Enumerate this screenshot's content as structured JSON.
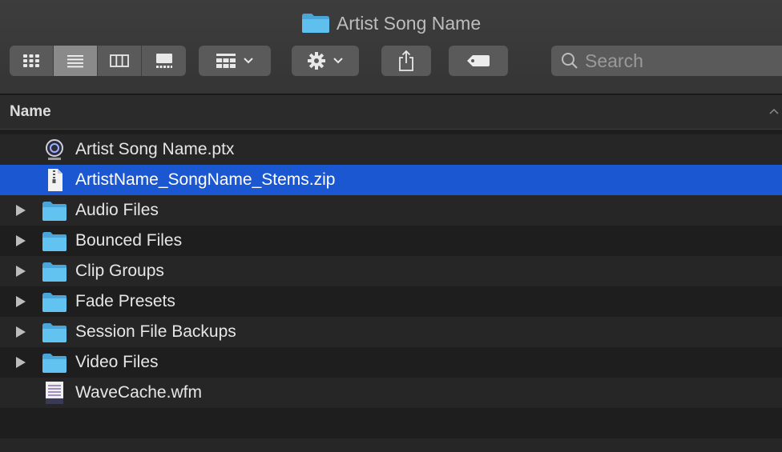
{
  "window": {
    "title": "Artist Song Name",
    "colors": {
      "accent": "#1a57d1",
      "folder": "#59b8e6"
    }
  },
  "toolbar": {
    "view_modes": [
      "icon-view",
      "list-view",
      "column-view",
      "gallery-view"
    ],
    "active_view": "list-view",
    "group_icon": "group-grid-icon",
    "action_icon": "gear-icon",
    "share_icon": "share-icon",
    "tag_icon": "tag-icon",
    "search": {
      "placeholder": "Search",
      "value": ""
    }
  },
  "columns": {
    "name": "Name"
  },
  "files": [
    {
      "name": "Artist Song Name.ptx",
      "kind": "session",
      "expandable": false,
      "selected": false
    },
    {
      "name": "ArtistName_SongName_Stems.zip",
      "kind": "zip",
      "expandable": false,
      "selected": true
    },
    {
      "name": "Audio Files",
      "kind": "folder",
      "expandable": true,
      "selected": false
    },
    {
      "name": "Bounced Files",
      "kind": "folder",
      "expandable": true,
      "selected": false
    },
    {
      "name": "Clip Groups",
      "kind": "folder",
      "expandable": true,
      "selected": false
    },
    {
      "name": "Fade Presets",
      "kind": "folder",
      "expandable": true,
      "selected": false
    },
    {
      "name": "Session File Backups",
      "kind": "folder",
      "expandable": true,
      "selected": false
    },
    {
      "name": "Video Files",
      "kind": "folder",
      "expandable": true,
      "selected": false
    },
    {
      "name": "WaveCache.wfm",
      "kind": "wavecache",
      "expandable": false,
      "selected": false
    }
  ]
}
